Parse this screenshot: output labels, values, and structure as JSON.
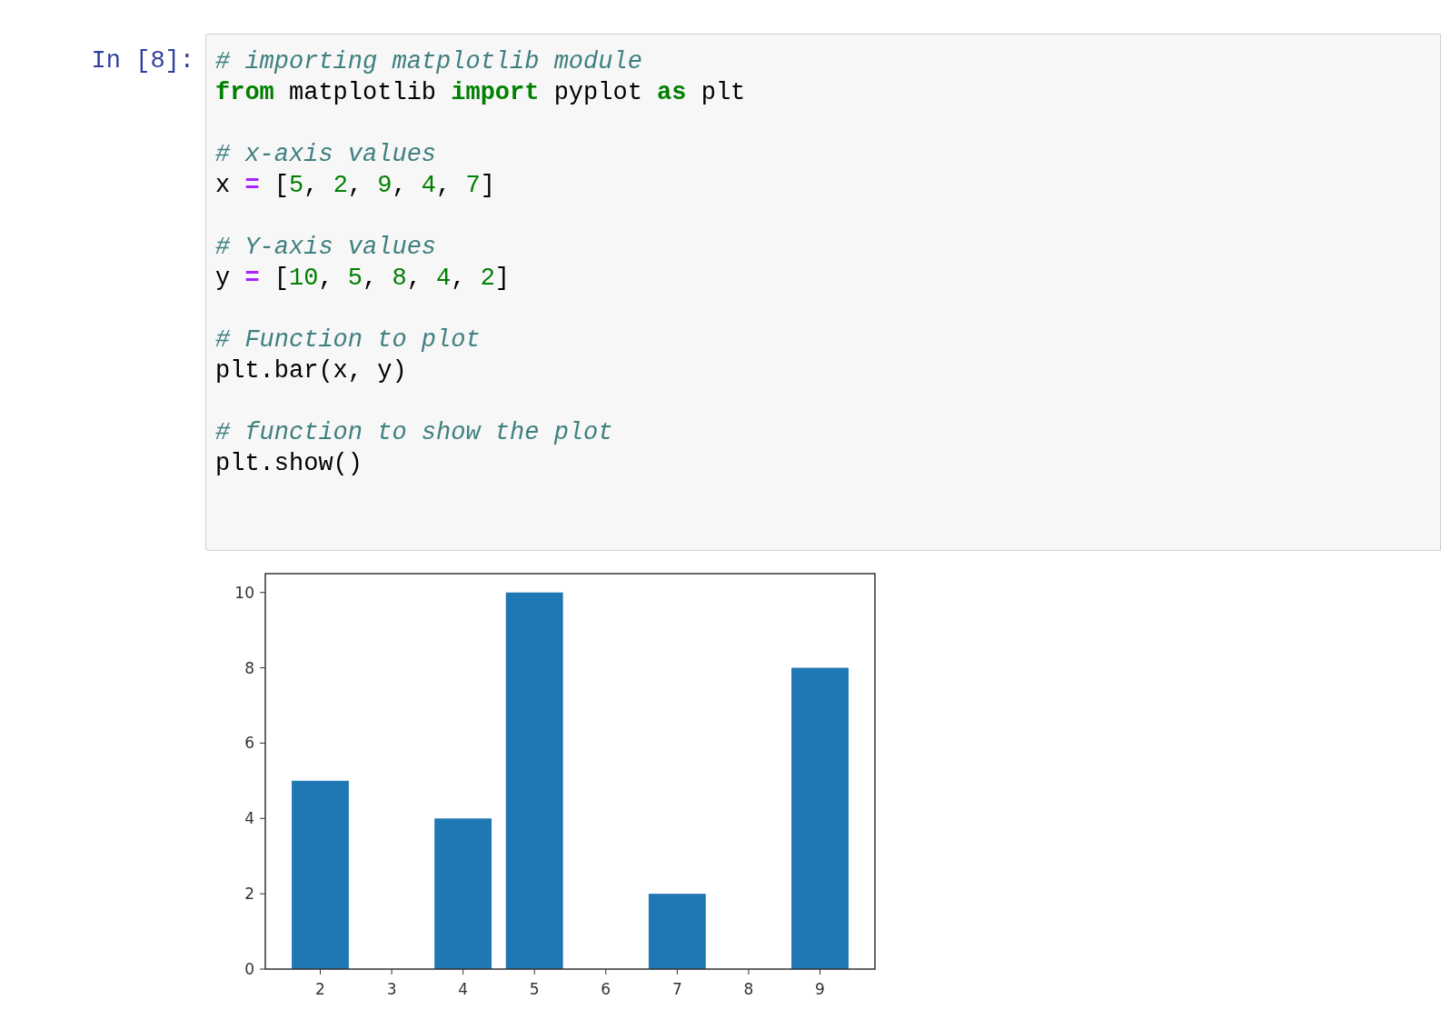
{
  "cell": {
    "prompt": "In [8]:",
    "code_blocks": [
      {
        "lines": [
          [
            {
              "kind": "comment",
              "text": "# importing matplotlib module"
            }
          ],
          [
            {
              "kind": "keyword",
              "text": "from"
            },
            {
              "kind": "plain",
              "text": " matplotlib "
            },
            {
              "kind": "keyword",
              "text": "import"
            },
            {
              "kind": "plain",
              "text": " pyplot "
            },
            {
              "kind": "keyword",
              "text": "as"
            },
            {
              "kind": "plain",
              "text": " plt"
            }
          ]
        ]
      },
      {
        "lines": [
          [
            {
              "kind": "comment",
              "text": "# x-axis values"
            }
          ],
          [
            {
              "kind": "plain",
              "text": "x "
            },
            {
              "kind": "operator",
              "text": "="
            },
            {
              "kind": "plain",
              "text": " ["
            },
            {
              "kind": "number",
              "text": "5"
            },
            {
              "kind": "plain",
              "text": ", "
            },
            {
              "kind": "number",
              "text": "2"
            },
            {
              "kind": "plain",
              "text": ", "
            },
            {
              "kind": "number",
              "text": "9"
            },
            {
              "kind": "plain",
              "text": ", "
            },
            {
              "kind": "number",
              "text": "4"
            },
            {
              "kind": "plain",
              "text": ", "
            },
            {
              "kind": "number",
              "text": "7"
            },
            {
              "kind": "plain",
              "text": "]"
            }
          ]
        ]
      },
      {
        "lines": [
          [
            {
              "kind": "comment",
              "text": "# Y-axis values"
            }
          ],
          [
            {
              "kind": "plain",
              "text": "y "
            },
            {
              "kind": "operator",
              "text": "="
            },
            {
              "kind": "plain",
              "text": " ["
            },
            {
              "kind": "number",
              "text": "10"
            },
            {
              "kind": "plain",
              "text": ", "
            },
            {
              "kind": "number",
              "text": "5"
            },
            {
              "kind": "plain",
              "text": ", "
            },
            {
              "kind": "number",
              "text": "8"
            },
            {
              "kind": "plain",
              "text": ", "
            },
            {
              "kind": "number",
              "text": "4"
            },
            {
              "kind": "plain",
              "text": ", "
            },
            {
              "kind": "number",
              "text": "2"
            },
            {
              "kind": "plain",
              "text": "]"
            }
          ]
        ]
      },
      {
        "lines": [
          [
            {
              "kind": "comment",
              "text": "# Function to plot"
            }
          ],
          [
            {
              "kind": "plain",
              "text": "plt.bar(x, y)"
            }
          ]
        ]
      },
      {
        "lines": [
          [
            {
              "kind": "comment",
              "text": "# function to show the plot"
            }
          ],
          [
            {
              "kind": "plain",
              "text": "plt.show()"
            }
          ]
        ]
      }
    ]
  },
  "output": {
    "chart_data": {
      "type": "bar",
      "x": [
        2,
        4,
        5,
        7,
        9
      ],
      "series": [
        {
          "color": "#1f77b4",
          "values": [
            5,
            4,
            10,
            2,
            8
          ]
        }
      ],
      "xlim": [
        1.23,
        9.77
      ],
      "ylim": [
        0,
        10.5
      ],
      "xticks": [
        2,
        3,
        4,
        5,
        6,
        7,
        8,
        9
      ],
      "yticks": [
        0,
        2,
        4,
        6,
        8,
        10
      ]
    }
  }
}
